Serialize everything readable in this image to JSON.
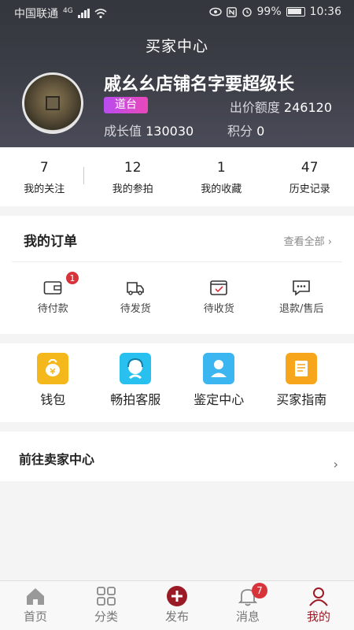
{
  "status_bar": {
    "carrier": "中国联通",
    "network": "4G",
    "battery": "99%",
    "time": "10:36"
  },
  "nav": {
    "title": "买家中心"
  },
  "profile": {
    "shop_name": "戚幺幺店铺名字要超级长",
    "level": "道台",
    "quota_label": "出价额度",
    "quota_value": "246120",
    "growth_label": "成长值",
    "growth_value": "130030",
    "points_label": "积分",
    "points_value": "0"
  },
  "stats": [
    {
      "count": "7",
      "label": "我的关注"
    },
    {
      "count": "12",
      "label": "我的参拍"
    },
    {
      "count": "1",
      "label": "我的收藏"
    },
    {
      "count": "47",
      "label": "历史记录"
    }
  ],
  "orders": {
    "title": "我的订单",
    "view_all": "查看全部",
    "items": [
      {
        "label": "待付款",
        "icon": "wallet-icon",
        "badge": "1"
      },
      {
        "label": "待发货",
        "icon": "truck-icon"
      },
      {
        "label": "待收货",
        "icon": "box-check-icon"
      },
      {
        "label": "退款/售后",
        "icon": "chat-dots-icon"
      }
    ]
  },
  "tools": [
    {
      "label": "钱包",
      "icon": "money-bag-icon",
      "color": "#f5b81c"
    },
    {
      "label": "畅拍客服",
      "icon": "customer-service-icon",
      "color": "#27c0ef"
    },
    {
      "label": "鉴定中心",
      "icon": "user-icon",
      "color": "#3cb6f0"
    },
    {
      "label": "买家指南",
      "icon": "book-icon",
      "color": "#f7a51b"
    }
  ],
  "seller_center": {
    "label": "前往卖家中心"
  },
  "tabbar": [
    {
      "label": "首页",
      "icon": "home-icon"
    },
    {
      "label": "分类",
      "icon": "grid-icon"
    },
    {
      "label": "发布",
      "icon": "plus-circle-icon"
    },
    {
      "label": "消息",
      "icon": "bell-icon",
      "badge": "7"
    },
    {
      "label": "我的",
      "icon": "person-icon",
      "active": true
    }
  ],
  "colors": {
    "accent": "#9a1a25",
    "badge": "#d6333a",
    "header_bg": "#3a3c45"
  }
}
